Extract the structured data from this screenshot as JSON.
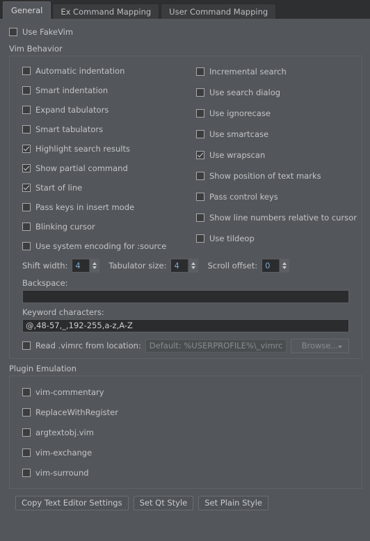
{
  "tabs": [
    {
      "label": "General",
      "selected": true
    },
    {
      "label": "Ex Command Mapping",
      "selected": false
    },
    {
      "label": "User Command Mapping",
      "selected": false
    }
  ],
  "use_fakevim": {
    "label": "Use FakeVim",
    "checked": false
  },
  "vim_behavior": {
    "title": "Vim Behavior",
    "left_column": [
      {
        "label": "Automatic indentation",
        "checked": false
      },
      {
        "label": "Smart indentation",
        "checked": false
      },
      {
        "label": "Expand tabulators",
        "checked": false
      },
      {
        "label": "Smart tabulators",
        "checked": false
      },
      {
        "label": "Highlight search results",
        "checked": true
      },
      {
        "label": "Show partial command",
        "checked": true
      },
      {
        "label": "Start of line",
        "checked": true
      },
      {
        "label": "Pass keys in insert mode",
        "checked": false
      },
      {
        "label": "Blinking cursor",
        "checked": false
      },
      {
        "label": "Use system encoding for :source",
        "checked": false
      }
    ],
    "right_column": [
      {
        "label": "Incremental search",
        "checked": false
      },
      {
        "label": "Use search dialog",
        "checked": false
      },
      {
        "label": "Use ignorecase",
        "checked": false
      },
      {
        "label": "Use smartcase",
        "checked": false
      },
      {
        "label": "Use wrapscan",
        "checked": true
      },
      {
        "label": "Show position of text marks",
        "checked": false
      },
      {
        "label": "Pass control keys",
        "checked": false
      },
      {
        "label": "Show line numbers relative to cursor",
        "checked": false
      },
      {
        "label": "Use tildeop",
        "checked": false
      }
    ],
    "numeric": {
      "shift_width_label": "Shift width:",
      "shift_width_value": "4",
      "tabulator_size_label": "Tabulator size:",
      "tabulator_size_value": "4",
      "scroll_offset_label": "Scroll offset:",
      "scroll_offset_value": "0"
    },
    "backspace_label": "Backspace:",
    "backspace_value": "",
    "keyword_label": "Keyword characters:",
    "keyword_value": "@,48-57,_,192-255,a-z,A-Z",
    "vimrc": {
      "checkbox_label": "Read .vimrc from location:",
      "checked": false,
      "path_value": "",
      "path_placeholder": "Default: %USERPROFILE%\\_vimrc",
      "browse_label": "Browse...",
      "browse_enabled": false
    }
  },
  "plugin_emulation": {
    "title": "Plugin Emulation",
    "items": [
      {
        "label": "vim-commentary",
        "checked": false
      },
      {
        "label": "ReplaceWithRegister",
        "checked": false
      },
      {
        "label": "argtextobj.vim",
        "checked": false
      },
      {
        "label": "vim-exchange",
        "checked": false
      },
      {
        "label": "vim-surround",
        "checked": false
      }
    ]
  },
  "buttons": [
    {
      "label": "Copy Text Editor Settings"
    },
    {
      "label": "Set Qt Style"
    },
    {
      "label": "Set Plain Style"
    }
  ],
  "colors": {
    "window_bg": "#53565a",
    "tabbar_bg": "#2e2f30",
    "field_bg": "#2b2c2e",
    "text": "#c3c5c7",
    "spin_value": "#7fa8d0",
    "frame_border": "#5f6266"
  }
}
